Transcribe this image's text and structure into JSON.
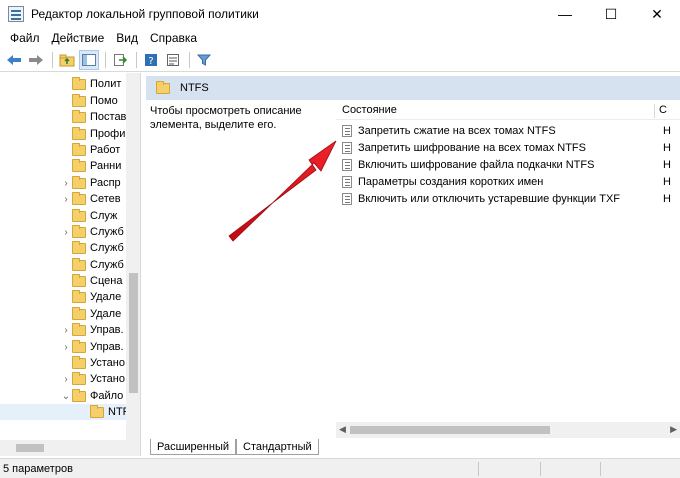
{
  "window": {
    "title": "Редактор локальной групповой политики",
    "minimize": "—",
    "maximize": "☐",
    "close": "✕"
  },
  "menu": [
    "Файл",
    "Действие",
    "Вид",
    "Справка"
  ],
  "toolbar": {
    "icons": [
      "back-icon",
      "forward-icon",
      "up-folder-icon",
      "show-hide-tree-icon",
      "export-list-icon",
      "help-icon",
      "properties-icon",
      "filter-icon"
    ]
  },
  "tree": {
    "items": [
      {
        "label": "Полит",
        "arrow": ""
      },
      {
        "label": "Помо",
        "arrow": ""
      },
      {
        "label": "Постав",
        "arrow": ""
      },
      {
        "label": "Профи",
        "arrow": ""
      },
      {
        "label": "Работ",
        "arrow": ""
      },
      {
        "label": "Ранни",
        "arrow": ""
      },
      {
        "label": "Распр",
        "arrow": "›"
      },
      {
        "label": "Сетев",
        "arrow": "›"
      },
      {
        "label": "Служ",
        "arrow": ""
      },
      {
        "label": "Служб",
        "arrow": "›"
      },
      {
        "label": "Служб",
        "arrow": ""
      },
      {
        "label": "Служб",
        "arrow": ""
      },
      {
        "label": "Сцена",
        "arrow": ""
      },
      {
        "label": "Удале",
        "arrow": ""
      },
      {
        "label": "Удале",
        "arrow": ""
      },
      {
        "label": "Управ.",
        "arrow": "›"
      },
      {
        "label": "Управ.",
        "arrow": "›"
      },
      {
        "label": "Устано",
        "arrow": ""
      },
      {
        "label": "Устано",
        "arrow": "›"
      },
      {
        "label": "Файло",
        "arrow": "⌄"
      },
      {
        "label": "NTF",
        "arrow": ""
      }
    ]
  },
  "pane": {
    "title": "NTFS",
    "description": "Чтобы просмотреть описание элемента, выделите его.",
    "column_state": "Состояние",
    "column2": "С"
  },
  "settings": [
    {
      "label": "Запретить сжатие на всех томах NTFS",
      "col2": "Н"
    },
    {
      "label": "Запретить шифрование на всех томах NTFS",
      "col2": "Н"
    },
    {
      "label": "Включить шифрование файла подкачки NTFS",
      "col2": "Н"
    },
    {
      "label": "Параметры создания коротких имен",
      "col2": "Н"
    },
    {
      "label": "Включить или отключить устаревшие функции TXF",
      "col2": "Н"
    }
  ],
  "tabs": {
    "extended": "Расширенный",
    "standard": "Стандартный"
  },
  "status": {
    "text": "5 параметров"
  },
  "colors": {
    "header_bg": "#d6e2ef",
    "arrow": "#e0141c"
  }
}
